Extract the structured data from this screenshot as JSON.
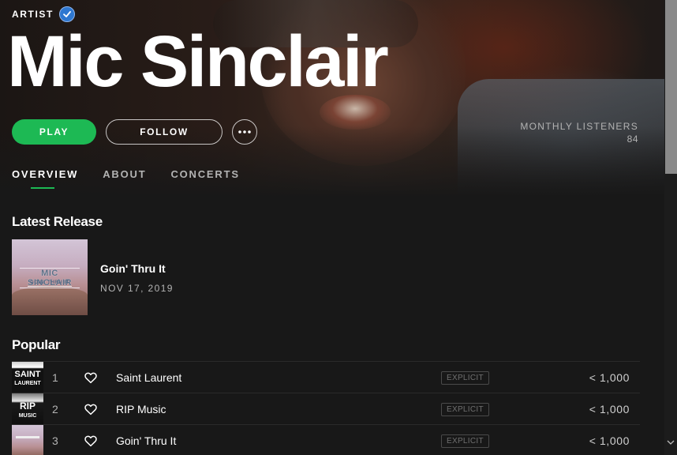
{
  "artist": {
    "label": "ARTIST",
    "name": "Mic Sinclair",
    "verified": true
  },
  "actions": {
    "play_label": "PLAY",
    "follow_label": "FOLLOW",
    "more_icon": "more-icon"
  },
  "stats": {
    "monthly_listeners_label": "MONTHLY LISTENERS",
    "monthly_listeners_count": "84"
  },
  "tabs": [
    {
      "label": "OVERVIEW",
      "active": true
    },
    {
      "label": "ABOUT",
      "active": false
    },
    {
      "label": "CONCERTS",
      "active": false
    }
  ],
  "latest_release": {
    "heading": "Latest Release",
    "title": "Goin' Thru It",
    "date": "NOV 17, 2019",
    "cover_title": "MIC SINCLAIR",
    "cover_subtitle": "GOIN' THRU IT"
  },
  "popular": {
    "heading": "Popular",
    "tracks": [
      {
        "num": "1",
        "title": "Saint Laurent",
        "explicit": "EXPLICIT",
        "plays": "< 1,000",
        "thumb_line1": "SAINT",
        "thumb_line2": "LAURENT"
      },
      {
        "num": "2",
        "title": "RIP Music",
        "explicit": "EXPLICIT",
        "plays": "< 1,000",
        "thumb_line1": "RIP",
        "thumb_line2": "MUSIC"
      },
      {
        "num": "3",
        "title": "Goin' Thru It",
        "explicit": "EXPLICIT",
        "plays": "< 1,000",
        "thumb_line1": "",
        "thumb_line2": ""
      }
    ]
  },
  "colors": {
    "accent": "#1db954",
    "verified": "#2e77d0",
    "background": "#181818"
  }
}
